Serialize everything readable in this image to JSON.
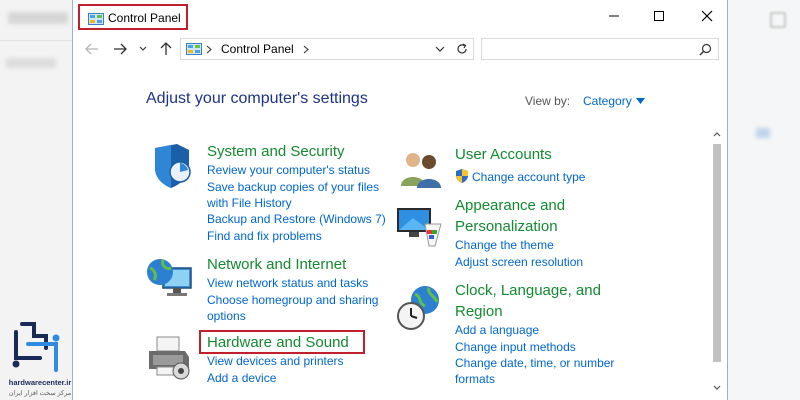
{
  "window": {
    "title": "Control Panel"
  },
  "address_bar": {
    "path_root": "Control Panel"
  },
  "search": {
    "placeholder": ""
  },
  "main": {
    "heading": "Adjust your computer's settings",
    "view_by_label": "View by:",
    "view_by_value": "Category"
  },
  "categories": {
    "system_security": {
      "title": "System and Security",
      "links": [
        "Review your computer's status",
        "Save backup copies of your files",
        "with File History",
        "Backup and Restore (Windows 7)",
        "Find and fix problems"
      ]
    },
    "network_internet": {
      "title": "Network and Internet",
      "links": [
        "View network status and tasks",
        "Choose homegroup and sharing",
        "options"
      ]
    },
    "hardware_sound": {
      "title": "Hardware and Sound",
      "links": [
        "View devices and printers",
        "Add a device"
      ]
    },
    "user_accounts": {
      "title": "User Accounts",
      "links": [
        "Change account type"
      ]
    },
    "appearance": {
      "title_line1": "Appearance and",
      "title_line2": "Personalization",
      "links": [
        "Change the theme",
        "Adjust screen resolution"
      ]
    },
    "clock_region": {
      "title_line1": "Clock, Language, and",
      "title_line2": "Region",
      "links": [
        "Add a language",
        "Change input methods",
        "Change date, time, or number",
        "formats"
      ]
    }
  },
  "logo": {
    "text": "hardwarecenter.ir",
    "subtext": "مرکز سخت افزار ایران"
  },
  "colors": {
    "category_title": "#138a30",
    "link": "#0066cc",
    "heading": "#1e3287",
    "highlight": "#c0202b"
  }
}
